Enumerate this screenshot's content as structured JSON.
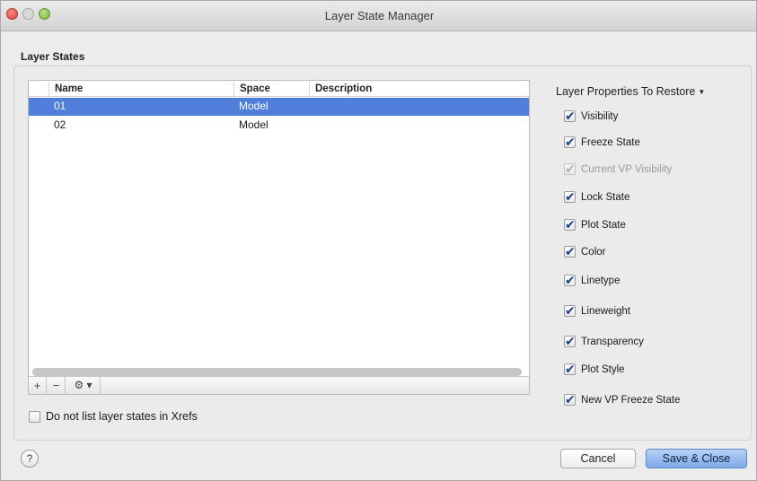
{
  "window": {
    "title": "Layer State Manager"
  },
  "layer_states": {
    "section_label": "Layer States",
    "columns": {
      "name": "Name",
      "space": "Space",
      "description": "Description"
    },
    "rows": [
      {
        "name": "01",
        "space": "Model",
        "description": "",
        "selected": true
      },
      {
        "name": "02",
        "space": "Model",
        "description": "",
        "selected": false
      }
    ],
    "toolbar": {
      "add": "+",
      "remove": "−",
      "options": "⚙ ▾"
    }
  },
  "properties": {
    "title": "Layer Properties To Restore",
    "items": [
      {
        "label": "Visibility",
        "checked": true,
        "enabled": true
      },
      {
        "label": "Freeze State",
        "checked": true,
        "enabled": true
      },
      {
        "label": "Current VP Visibility",
        "checked": true,
        "enabled": false
      },
      {
        "label": "Lock State",
        "checked": true,
        "enabled": true
      },
      {
        "label": "Plot State",
        "checked": true,
        "enabled": true
      },
      {
        "label": "Color",
        "checked": true,
        "enabled": true
      },
      {
        "label": "Linetype",
        "checked": true,
        "enabled": true
      },
      {
        "label": "Lineweight",
        "checked": true,
        "enabled": true
      },
      {
        "label": "Transparency",
        "checked": true,
        "enabled": true
      },
      {
        "label": "Plot Style",
        "checked": true,
        "enabled": true
      },
      {
        "label": "New VP Freeze State",
        "checked": true,
        "enabled": true
      }
    ]
  },
  "options": {
    "xref_label": "Do not list layer states in Xrefs",
    "xref_checked": false
  },
  "buttons": {
    "help": "?",
    "cancel": "Cancel",
    "save": "Save & Close"
  }
}
